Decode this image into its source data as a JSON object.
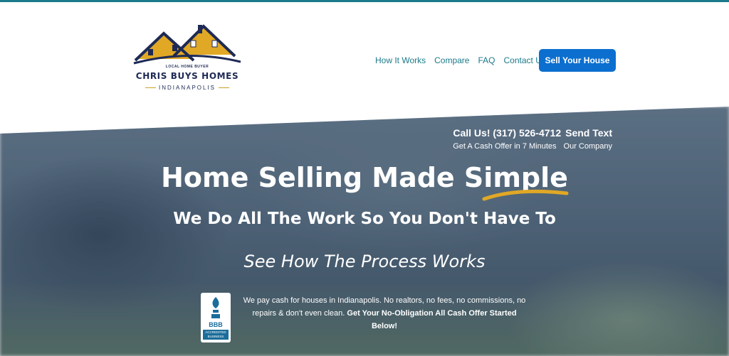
{
  "logo": {
    "tagline": "LOCAL HOME BUYER",
    "name": "CHRIS BUYS HOMES",
    "city": "INDIANAPOLIS",
    "colors": {
      "navy": "#1e2a55",
      "gold": "#e0a825"
    }
  },
  "nav": {
    "links": [
      "How It Works",
      "Compare",
      "FAQ",
      "Contact Us"
    ],
    "cta": "Sell Your House",
    "cta_color": "#0c6fcf",
    "link_color": "#1b7a8a"
  },
  "hero": {
    "call": "Call Us! (317) 526-4712",
    "send_text": "Send Text",
    "offer_link": "Get A Cash Offer in 7 Minutes",
    "company_link": "Our Company",
    "headline": "Home Selling Made Simple",
    "subheadline": "We Do All The Work So You Don't Have To",
    "process_link": "See How The Process Works",
    "blurb_normal": "We pay cash for houses in Indianapolis. No realtors, no fees, no commissions, no repairs & don't even clean. ",
    "blurb_bold": "Get Your No-Obligation All Cash Offer Started Below!",
    "accent_color": "#e0a825"
  },
  "bbb": {
    "label": "BBB",
    "accredited": "ACCREDITED BUSINESS",
    "color": "#1b6d9b"
  }
}
